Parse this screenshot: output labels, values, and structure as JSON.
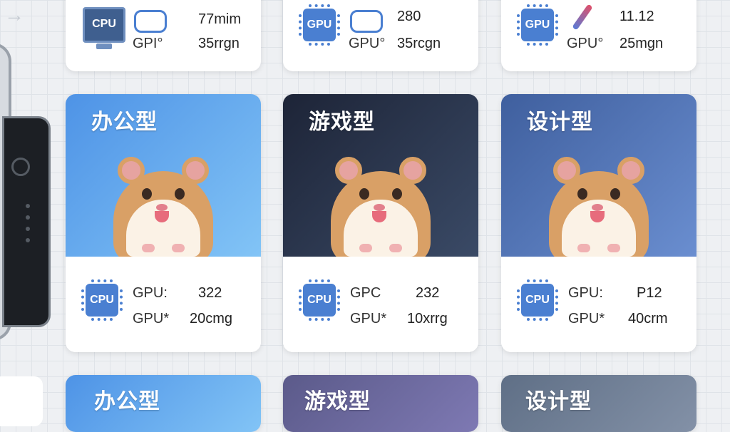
{
  "top_row": [
    {
      "icon_label": "CPU",
      "label1": "GPI°",
      "value1": "77mim",
      "value2": "35rrgn",
      "secondary_icon": "gamepad-icon"
    },
    {
      "icon_label": "GPU",
      "label1": "GPU°",
      "value1": "280",
      "value2": "35rcgn",
      "secondary_icon": "gamepad-icon"
    },
    {
      "icon_label": "GPU",
      "label1": "GPU°",
      "value1": "11.12",
      "value2": "25mgn",
      "secondary_icon": "brush-icon"
    }
  ],
  "middle_row": [
    {
      "title": "办公型",
      "cpu": "CPU",
      "label1": "GPU:",
      "value1": "322",
      "label2": "GPU*",
      "value2": "20cmg",
      "bg_from": "#4e93e6",
      "bg_to": "#82c4f6"
    },
    {
      "title": "游戏型",
      "cpu": "CPU",
      "label1": "GPC",
      "value1": "232",
      "label2": "GPU*",
      "value2": "10xrrg",
      "bg_from": "#1d2437",
      "bg_to": "#3a4a66"
    },
    {
      "title": "设计型",
      "cpu": "CPU",
      "label1": "GPU:",
      "value1": "P12",
      "label2": "GPU*",
      "value2": "40crm",
      "bg_from": "#3f5f9e",
      "bg_to": "#6a8ed0"
    }
  ],
  "bottom_row": [
    {
      "title": "办公型"
    },
    {
      "title": "游戏型"
    },
    {
      "title": "设计型"
    }
  ]
}
